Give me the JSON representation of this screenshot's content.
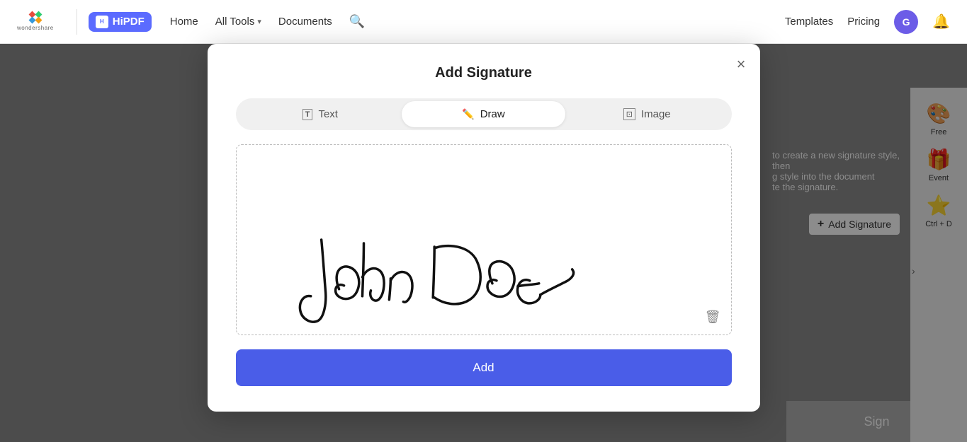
{
  "navbar": {
    "brand": "wondershare",
    "hipdf": "HiPDF",
    "links": [
      {
        "label": "Home",
        "hasChevron": false
      },
      {
        "label": "All Tools",
        "hasChevron": true
      },
      {
        "label": "Documents",
        "hasChevron": false
      }
    ],
    "search_icon": "search",
    "right_links": [
      {
        "label": "Templates"
      },
      {
        "label": "Pricing"
      }
    ],
    "avatar_letter": "G",
    "bell_icon": "🔔"
  },
  "right_panel": {
    "chevron": "›",
    "items": [
      {
        "icon": "🎨",
        "label": "Free"
      },
      {
        "icon": "🎁",
        "label": "Event"
      },
      {
        "icon": "⭐",
        "label": "Ctrl + D"
      }
    ]
  },
  "hint": {
    "line1": "to create a new signature style, then",
    "line2": "g style into the document",
    "line3": "te the signature."
  },
  "add_signature_button": "+ Add Signature",
  "sign_button": "Sign",
  "modal": {
    "title": "Add Signature",
    "close_icon": "×",
    "tabs": [
      {
        "label": "Text",
        "icon": "T",
        "active": false
      },
      {
        "label": "Draw",
        "icon": "✏",
        "active": true
      },
      {
        "label": "Image",
        "icon": "⊡",
        "active": false
      }
    ],
    "add_button_label": "Add",
    "trash_icon": "🗑",
    "signature_text": "John Doe"
  },
  "colors": {
    "primary": "#4a5de8",
    "accent": "#6c5ce7",
    "tab_active_bg": "#ffffff",
    "tab_inactive_bg": "#f0f0f0"
  }
}
